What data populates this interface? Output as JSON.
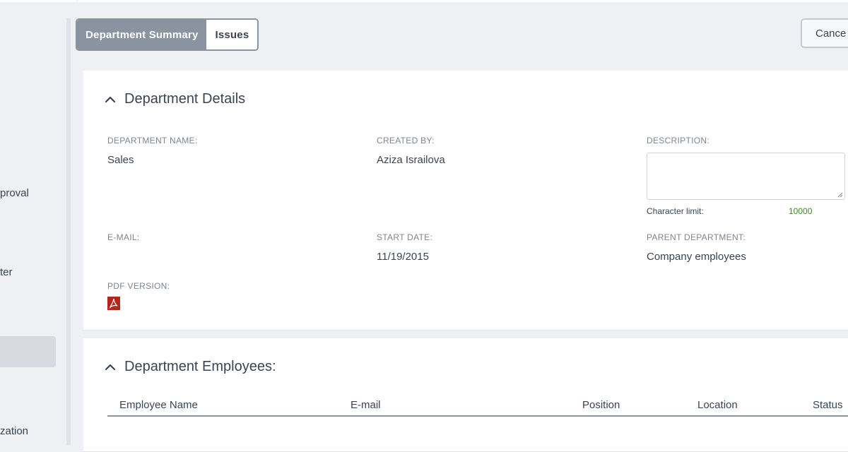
{
  "sidebar": {
    "items": [
      {
        "label": "proval"
      },
      {
        "label": "ter"
      },
      {
        "label": ""
      },
      {
        "label": "zation"
      }
    ]
  },
  "tabs": [
    {
      "label": "Department Summary",
      "active": true
    },
    {
      "label": "Issues",
      "active": false
    }
  ],
  "actions": {
    "cancel_label": "Cance"
  },
  "details": {
    "title": "Department Details",
    "department_name_label": "DEPARTMENT NAME:",
    "department_name_value": "Sales",
    "created_by_label": "CREATED BY:",
    "created_by_value": "Aziza Israilova",
    "description_label": "DESCRIPTION:",
    "description_value": "",
    "char_limit_label": "Character limit:",
    "char_limit_value": "10000",
    "email_label": "E-MAIL:",
    "email_value": "",
    "start_date_label": "START DATE:",
    "start_date_value": "11/19/2015",
    "parent_department_label": "PARENT DEPARTMENT:",
    "parent_department_value": "Company employees",
    "pdf_version_label": "PDF VERSION:"
  },
  "employees": {
    "title": "Department Employees:",
    "columns": [
      "Employee Name",
      "E-mail",
      "Position",
      "Location",
      "Status"
    ]
  },
  "colors": {
    "accent_gray": "#8a939f",
    "char_limit_green": "#3a8a2a",
    "pdf_red": "#b3261e"
  },
  "icons": {
    "collapse": "chevron-up-icon",
    "pdf": "pdf-icon"
  }
}
